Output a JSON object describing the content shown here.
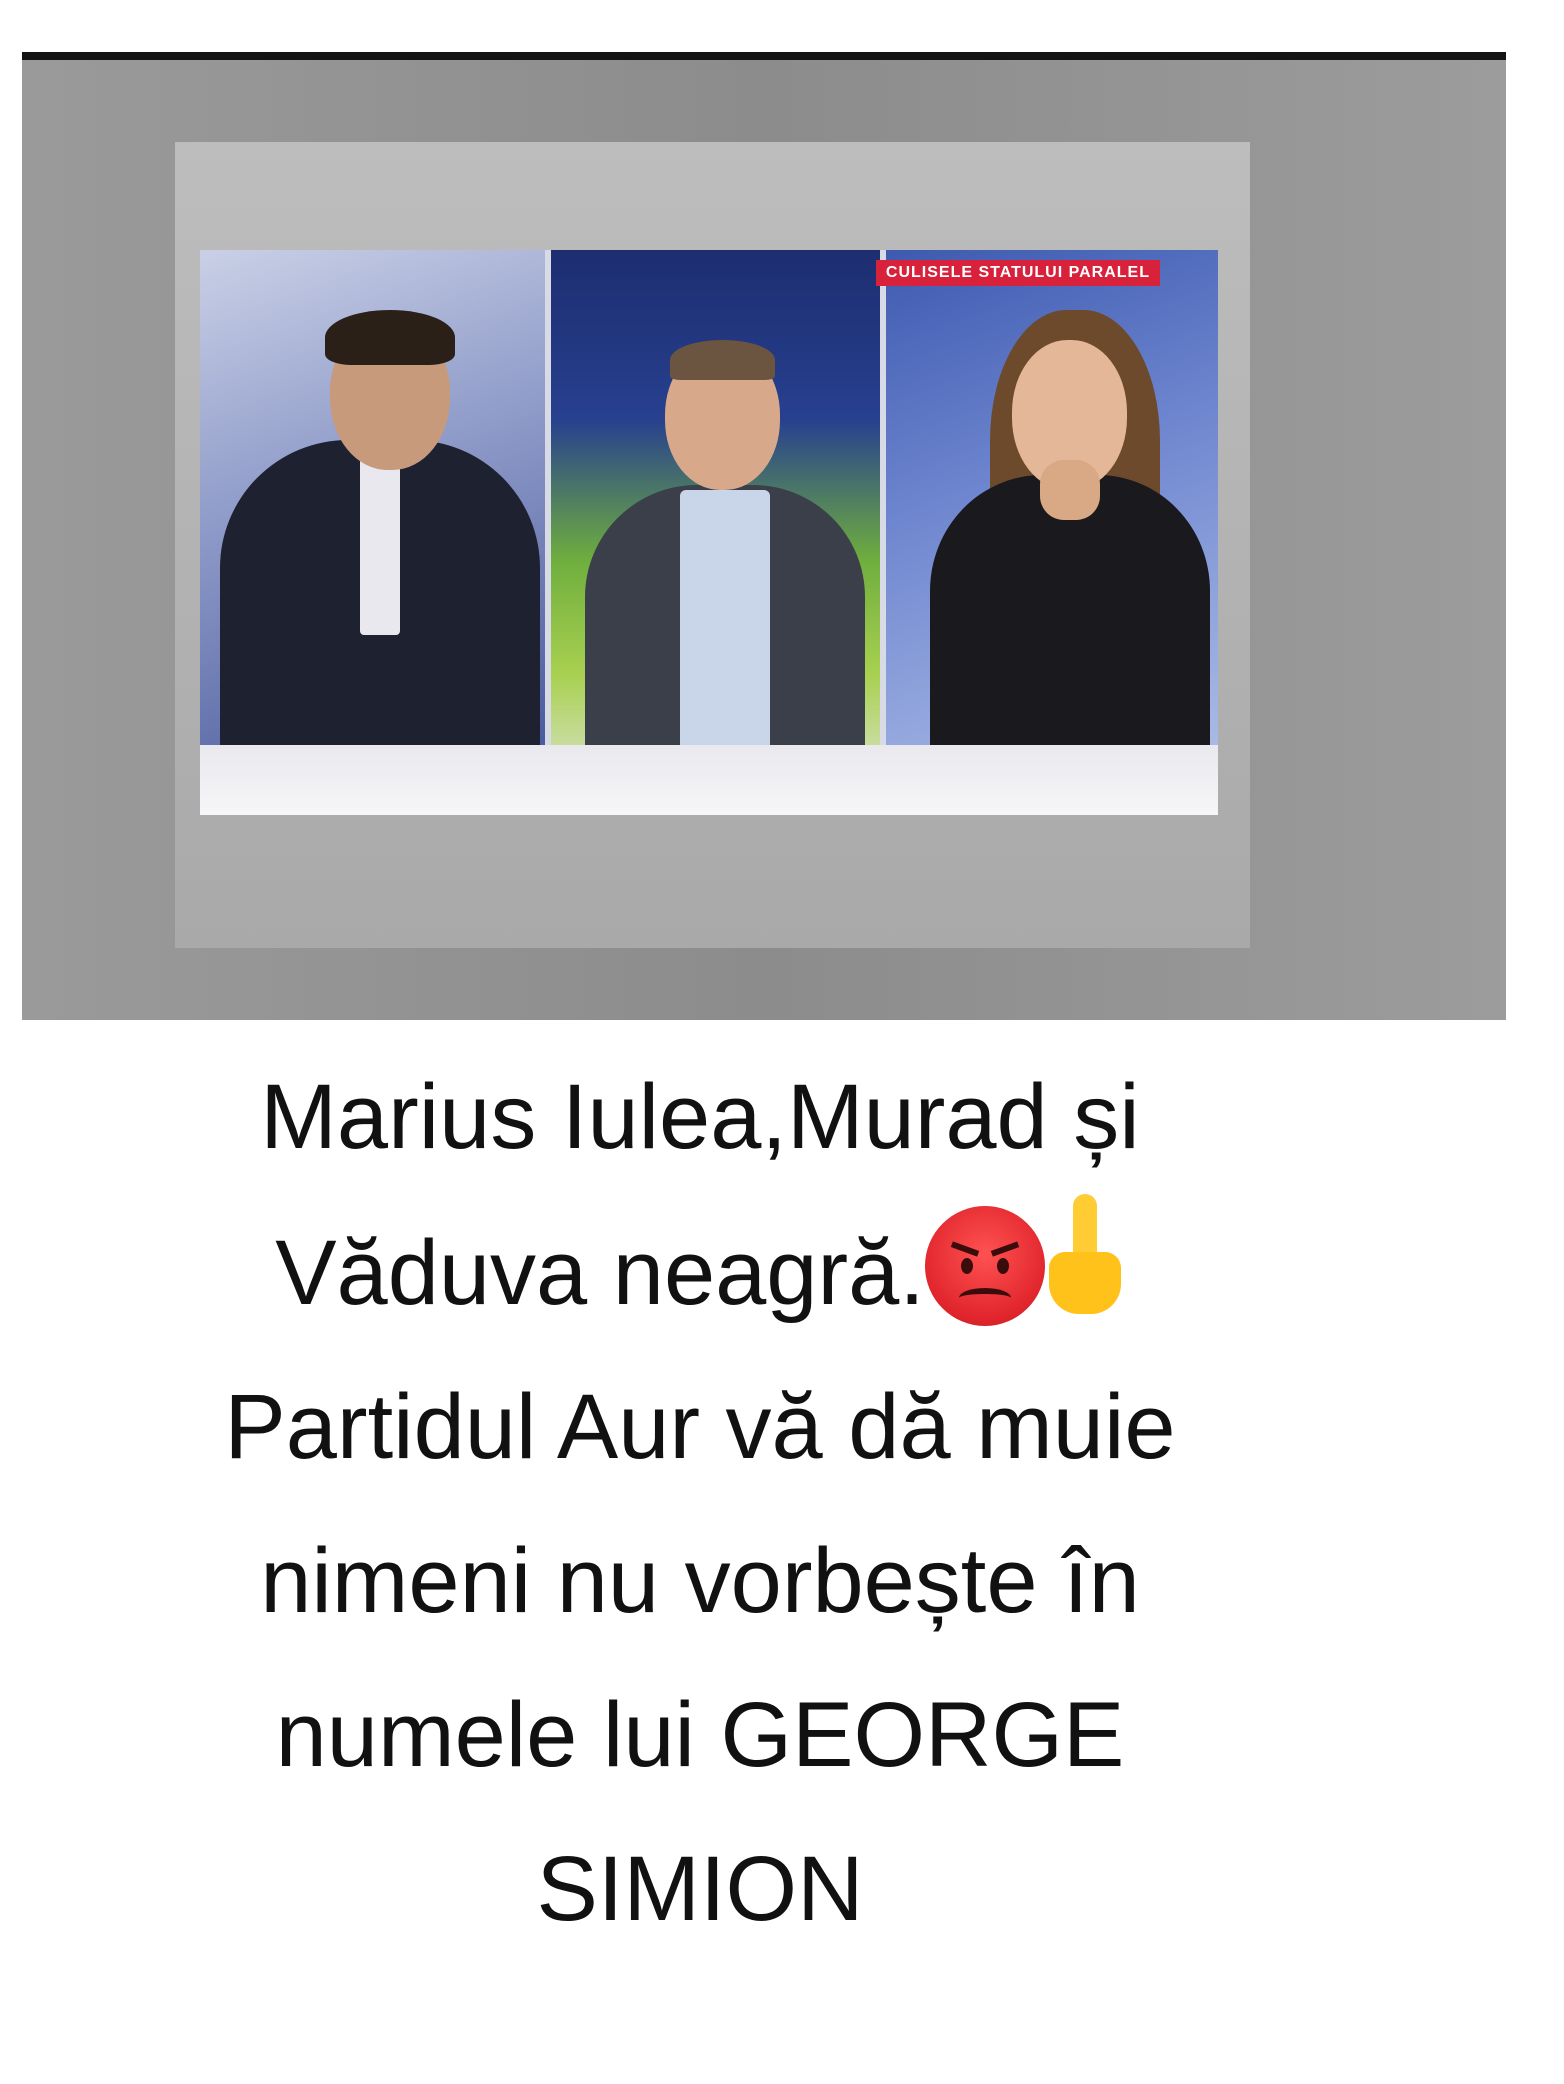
{
  "video": {
    "banner_text": "CULISELE STATULUI PARALEL"
  },
  "caption": {
    "line1": "Marius Iulea,Murad și",
    "line2": "Văduva neagră.",
    "line2_emoji_1": "angry-face-icon",
    "line2_emoji_2": "middle-finger-icon",
    "line3": "Partidul Aur vă dă muie",
    "line4": "nimeni nu vorbește în",
    "line5": "numele lui GEORGE",
    "line6": "SIMION"
  }
}
